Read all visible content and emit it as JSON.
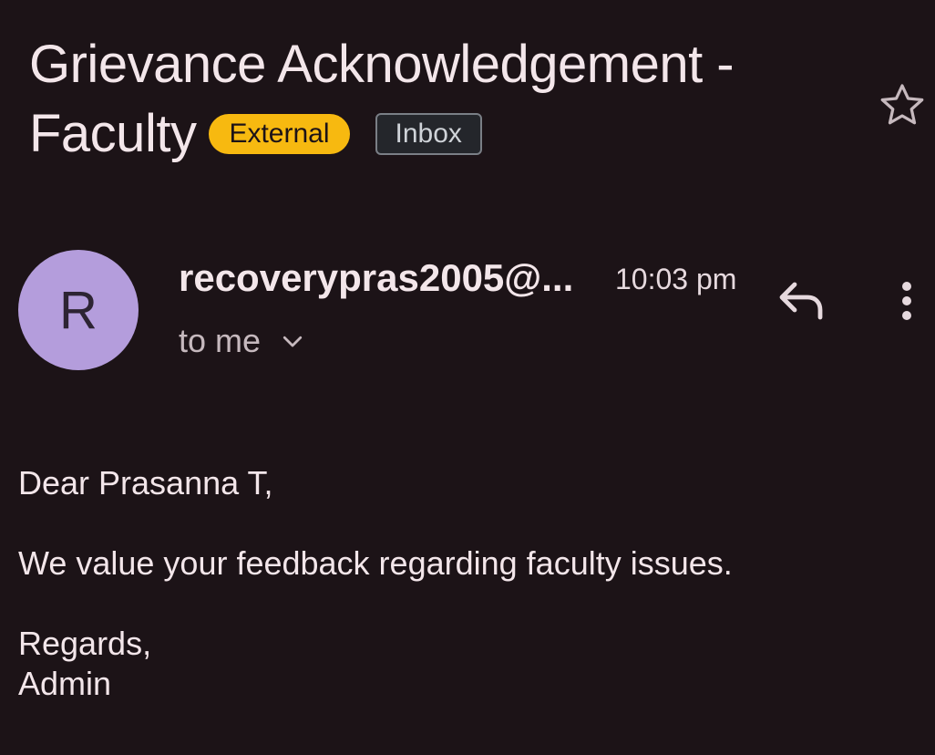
{
  "email": {
    "subject_line1": "Grievance Acknowledgement -",
    "subject_line2": "Faculty",
    "labels": {
      "external": "External",
      "inbox": "Inbox"
    },
    "sender": {
      "avatar_initial": "R",
      "name": "recoverypras2005@...",
      "time": "10:03 pm",
      "recipient": "to me"
    },
    "body": {
      "greeting": "Dear Prasanna T,",
      "message": "We value your feedback regarding faculty issues.",
      "closing": "Regards,",
      "signature": "Admin"
    }
  },
  "icons": {
    "star": "star-icon",
    "reply": "reply-icon",
    "more": "more-vert-icon",
    "chevron": "chevron-down-icon"
  },
  "colors": {
    "background": "#1c1317",
    "text": "#f3e6ea",
    "external_badge": "#f7b910",
    "inbox_badge_border": "#7a7f86",
    "avatar": "#b49ddc"
  }
}
